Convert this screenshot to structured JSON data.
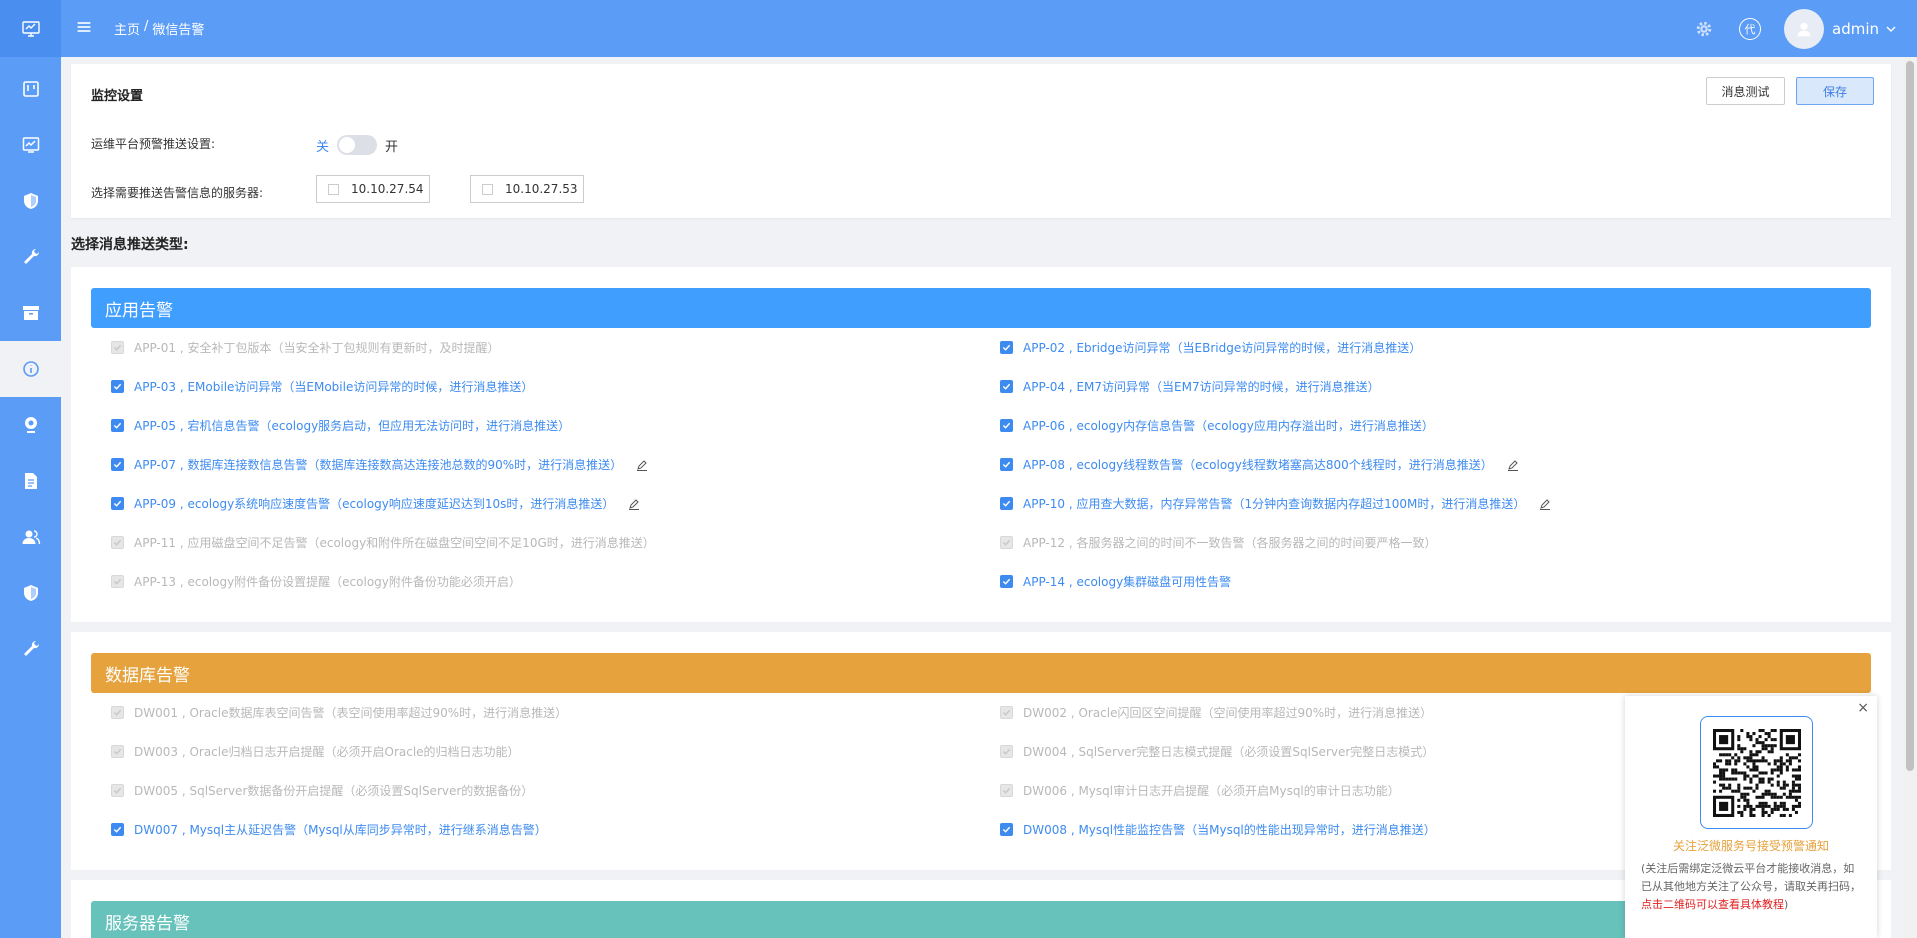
{
  "header": {
    "breadcrumb_home": "主页",
    "breadcrumb_sep": "/",
    "breadcrumb_current": "微信告警",
    "proxy_label": "代",
    "user_name": "admin"
  },
  "settings": {
    "title": "监控设置",
    "btn_test": "消息测试",
    "btn_save": "保存",
    "push_label": "运维平台预警推送设置:",
    "toggle_off": "关",
    "toggle_on": "开",
    "toggle_state": "off",
    "server_label": "选择需要推送告警信息的服务器:",
    "servers": [
      "10.10.27.54",
      "10.10.27.53"
    ]
  },
  "section_heading": "选择消息推送类型:",
  "app_alerts": {
    "title": "应用告警",
    "color": "#409eff",
    "items": [
      {
        "text": "APP-01 , 安全补丁包版本（当安全补丁包规则有更新时，及时提醒）",
        "state": "dis"
      },
      {
        "text": "APP-02 , Ebridge访问异常（当EBridge访问异常的时候，进行消息推送）",
        "state": "on"
      },
      {
        "text": "APP-03 , EMobile访问异常（当EMobile访问异常的时候，进行消息推送）",
        "state": "on"
      },
      {
        "text": "APP-04 , EM7访问异常（当EM7访问异常的时候，进行消息推送）",
        "state": "on"
      },
      {
        "text": "APP-05 , 宕机信息告警（ecology服务启动，但应用无法访问时，进行消息推送）",
        "state": "on"
      },
      {
        "text": "APP-06 , ecology内存信息告警（ecology应用内存溢出时，进行消息推送）",
        "state": "on"
      },
      {
        "text": "APP-07 , 数据库连接数信息告警（数据库连接数高达连接池总数的90%时，进行消息推送）",
        "state": "on",
        "edit": true
      },
      {
        "text": "APP-08 , ecology线程数告警（ecology线程数堵塞高达800个线程时，进行消息推送）",
        "state": "on",
        "edit": true
      },
      {
        "text": "APP-09 , ecology系统响应速度告警（ecology响应速度延迟达到10s时，进行消息推送）",
        "state": "on",
        "edit": true
      },
      {
        "text": "APP-10 , 应用查大数据，内存异常告警（1分钟内查询数据内存超过100M时，进行消息推送）",
        "state": "on",
        "edit": true
      },
      {
        "text": "APP-11 , 应用磁盘空间不足告警（ecology和附件所在磁盘空间空间不足10G时，进行消息推送）",
        "state": "dis"
      },
      {
        "text": "APP-12 , 各服务器之间的时间不一致告警（各服务器之间的时间要严格一致）",
        "state": "dis"
      },
      {
        "text": "APP-13 , ecology附件备份设置提醒（ecology附件备份功能必须开启）",
        "state": "dis"
      },
      {
        "text": "APP-14 , ecology集群磁盘可用性告警",
        "state": "on"
      }
    ]
  },
  "db_alerts": {
    "title": "数据库告警",
    "color": "#e6a23c",
    "items": [
      {
        "text": "DW001 , Oracle数据库表空间告警（表空间使用率超过90%时，进行消息推送）",
        "state": "dis"
      },
      {
        "text": "DW002 , Oracle闪回区空间提醒（空间使用率超过90%时，进行消息推送）",
        "state": "dis"
      },
      {
        "text": "DW003 , Oracle归档日志开启提醒（必须开启Oracle的归档日志功能）",
        "state": "dis"
      },
      {
        "text": "DW004 , SqlServer完整日志模式提醒（必须设置SqlServer完整日志模式）",
        "state": "dis"
      },
      {
        "text": "DW005 , SqlServer数据备份开启提醒（必须设置SqlServer的数据备份）",
        "state": "dis"
      },
      {
        "text": "DW006 , Mysql审计日志开启提醒（必须开启Mysql的审计日志功能）",
        "state": "dis"
      },
      {
        "text": "DW007 , Mysql主从延迟告警（Mysql从库同步异常时，进行继系消息告警）",
        "state": "on"
      },
      {
        "text": "DW008 , Mysql性能监控告警（当Mysql的性能出现异常时，进行消息推送）",
        "state": "on"
      }
    ]
  },
  "server_alerts": {
    "title": "服务器告警",
    "color": "#67c2bb"
  },
  "qr_popup": {
    "close": "×",
    "title": "关注泛微服务号接受预警通知",
    "desc": "(关注后需绑定泛微云平台才能接收消息，如已从其他地方关注了公众号，请取关再扫码，",
    "desc_red": "点击二维码可以查看具体教程",
    "desc_end": ")"
  }
}
